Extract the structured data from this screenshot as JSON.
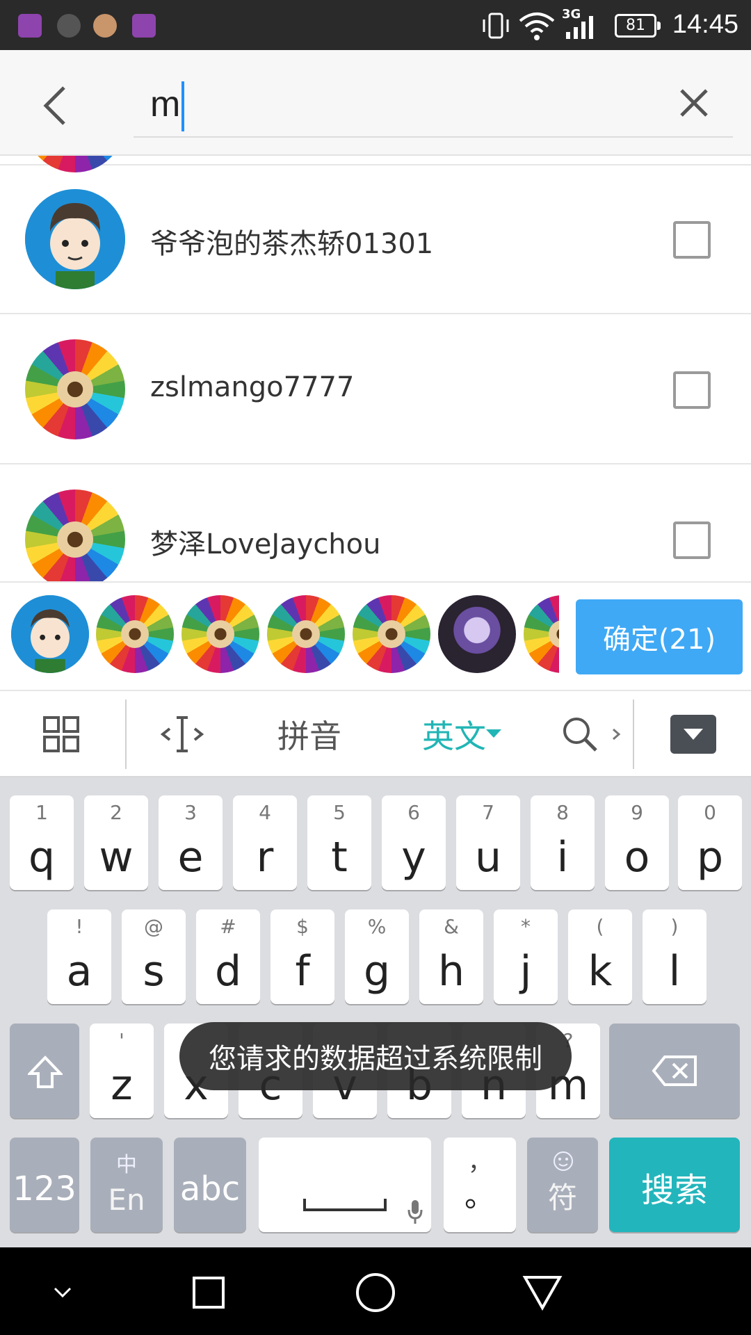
{
  "status_bar": {
    "network": "3G",
    "battery": "81",
    "time": "14:45"
  },
  "search": {
    "value": "m"
  },
  "contacts": [
    {
      "name": "爷爷泡的茶杰轿01301",
      "avatar": "cartoon"
    },
    {
      "name": "zslmango7777",
      "avatar": "pencils"
    },
    {
      "name": "梦泽LoveJaychou",
      "avatar": "pencils"
    }
  ],
  "selected": {
    "confirm_label": "确定(21)"
  },
  "keyboard_toolbar": {
    "pinyin_label": "拼音",
    "english_label": "英文"
  },
  "keyboard": {
    "row1": [
      {
        "main": "q",
        "hint": "1"
      },
      {
        "main": "w",
        "hint": "2"
      },
      {
        "main": "e",
        "hint": "3"
      },
      {
        "main": "r",
        "hint": "4"
      },
      {
        "main": "t",
        "hint": "5"
      },
      {
        "main": "y",
        "hint": "6"
      },
      {
        "main": "u",
        "hint": "7"
      },
      {
        "main": "i",
        "hint": "8"
      },
      {
        "main": "o",
        "hint": "9"
      },
      {
        "main": "p",
        "hint": "0"
      }
    ],
    "row2": [
      {
        "main": "a",
        "hint": "!"
      },
      {
        "main": "s",
        "hint": "@"
      },
      {
        "main": "d",
        "hint": "#"
      },
      {
        "main": "f",
        "hint": "$"
      },
      {
        "main": "g",
        "hint": "%"
      },
      {
        "main": "h",
        "hint": "&"
      },
      {
        "main": "j",
        "hint": "*"
      },
      {
        "main": "k",
        "hint": "("
      },
      {
        "main": "l",
        "hint": ")"
      }
    ],
    "row3": [
      {
        "main": "z",
        "hint": "'"
      },
      {
        "main": "x",
        "hint": ""
      },
      {
        "main": "c",
        "hint": ""
      },
      {
        "main": "v",
        "hint": ""
      },
      {
        "main": "b",
        "hint": ""
      },
      {
        "main": "n",
        "hint": ""
      },
      {
        "main": "m",
        "hint": "?"
      }
    ],
    "num_label": "123",
    "lang_top": "中",
    "lang_bottom": "En",
    "abc_label": "abc",
    "punct_top": "，",
    "punct_main": "。",
    "symbol_label": "符",
    "search_label": "搜索"
  },
  "toast": "您请求的数据超过系统限制"
}
